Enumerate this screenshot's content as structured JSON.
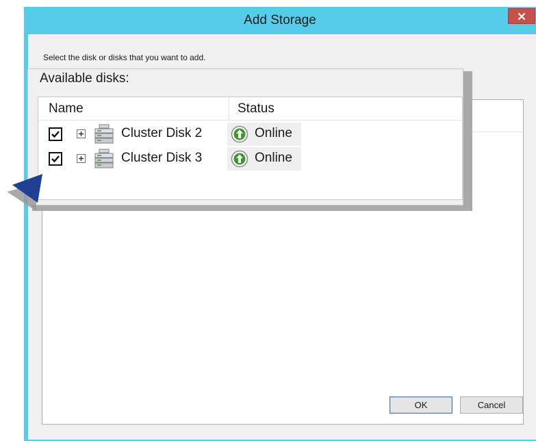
{
  "window": {
    "title": "Add Storage",
    "close_label": "x",
    "instruction": "Select the disk or disks that you want to add."
  },
  "callout": {
    "title": "Available disks:",
    "columns": {
      "name": "Name",
      "status": "Status"
    },
    "rows": [
      {
        "name": "Cluster Disk 2",
        "status": "Online",
        "checked": true,
        "icon": "cluster-disk-icon",
        "status_icon": "online-arrow-icon"
      },
      {
        "name": "Cluster Disk 3",
        "status": "Online",
        "checked": true,
        "icon": "cluster-disk-icon",
        "status_icon": "online-arrow-icon"
      }
    ]
  },
  "buttons": {
    "ok": "OK",
    "cancel": "Cancel"
  },
  "colors": {
    "titlebar": "#55cdea",
    "close": "#c7504c",
    "online_green": "#3a9a2c",
    "pointer": "#1f3f95"
  }
}
